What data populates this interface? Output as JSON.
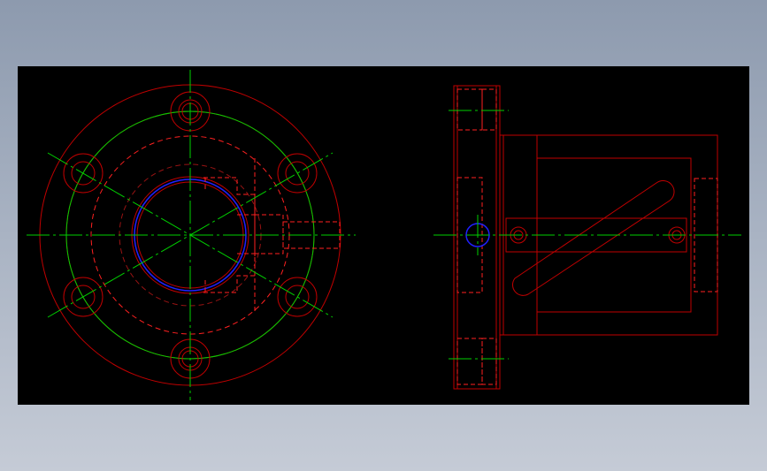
{
  "drawing": {
    "views": [
      "front-view",
      "side-view"
    ],
    "colors": {
      "background": "#000000",
      "outline": "#ff0000",
      "centerline": "#00ff00",
      "highlight": "#0000ff",
      "page_gradient_top": "#8d9aae",
      "page_gradient_bottom": "#c5cbd6"
    },
    "front_view": {
      "bolt_hole_count": 6
    }
  }
}
